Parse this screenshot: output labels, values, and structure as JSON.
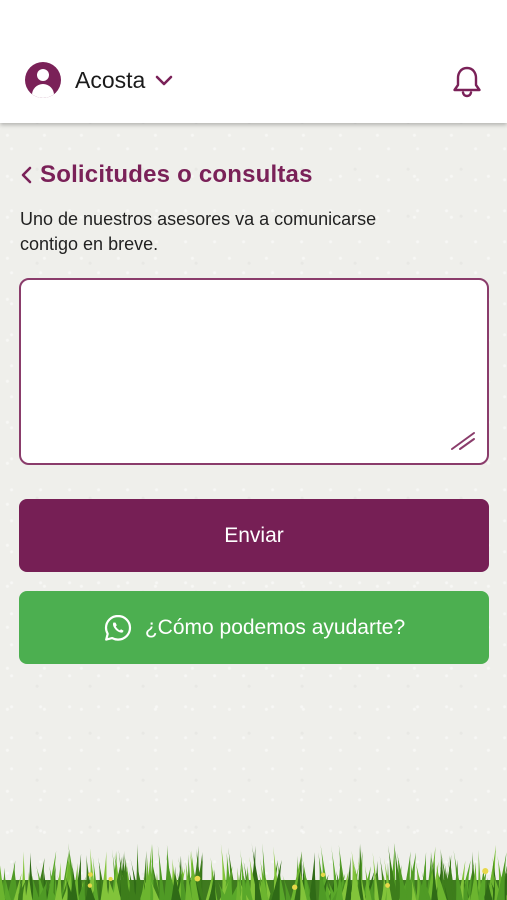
{
  "header": {
    "user_name": "Acosta"
  },
  "page": {
    "title": "Solicitudes o consultas",
    "description": "Uno de nuestros asesores va a comunicarse contigo en breve."
  },
  "form": {
    "message_value": "",
    "send_label": "Enviar",
    "whatsapp_label": "¿Cómo podemos ayudarte?"
  },
  "colors": {
    "brand": "#7a2158",
    "send_button": "#761f55",
    "whatsapp_button": "#4caf50"
  },
  "icons": [
    "user-avatar-icon",
    "chevron-down-icon",
    "bell-icon",
    "back-chevron-icon",
    "resize-handle-icon",
    "whatsapp-icon"
  ]
}
